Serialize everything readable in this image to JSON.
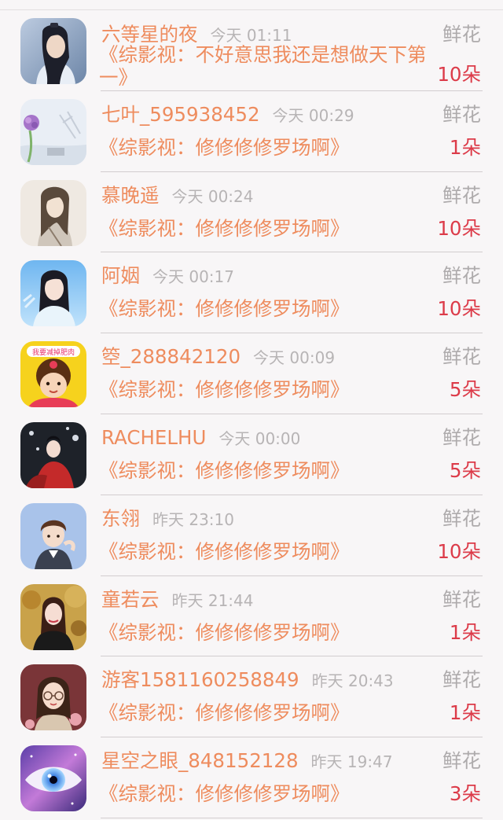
{
  "rewards": [
    {
      "name": "六等星的夜",
      "time": "今天 01:11",
      "gift": "鲜花",
      "book": "《综影视：不好意思我还是想做天下第一》",
      "count": "10朵",
      "avatar_icon": "avatar-photo-man-ancient"
    },
    {
      "name": "七叶_595938452",
      "time": "今天 00:29",
      "gift": "鲜花",
      "book": "《综影视：修修修修罗场啊》",
      "count": "1朵",
      "avatar_icon": "avatar-illustration-flower"
    },
    {
      "name": "慕晚遥",
      "time": "今天 00:24",
      "gift": "鲜花",
      "book": "《综影视：修修修修罗场啊》",
      "count": "10朵",
      "avatar_icon": "avatar-illustration-swordsman"
    },
    {
      "name": "阿姻",
      "time": "今天 00:17",
      "gift": "鲜花",
      "book": "《综影视：修修修修罗场啊》",
      "count": "10朵",
      "avatar_icon": "avatar-photo-girl-blue"
    },
    {
      "name": "箜_288842120",
      "time": "今天 00:09",
      "gift": "鲜花",
      "book": "《综影视：修修修修罗场啊》",
      "count": "5朵",
      "avatar_icon": "avatar-cartoon-girl-yellow"
    },
    {
      "name": "RACHELHU",
      "time": "今天 00:00",
      "gift": "鲜花",
      "book": "《综影视：修修修修罗场啊》",
      "count": "5朵",
      "avatar_icon": "avatar-photo-woman-red"
    },
    {
      "name": "东翎",
      "time": "昨天 23:10",
      "gift": "鲜花",
      "book": "《综影视：修修修修罗场啊》",
      "count": "10朵",
      "avatar_icon": "avatar-photo-boy-blue"
    },
    {
      "name": "童若云",
      "time": "昨天 21:44",
      "gift": "鲜花",
      "book": "《综影视：修修修修罗场啊》",
      "count": "1朵",
      "avatar_icon": "avatar-photo-woman-autumn"
    },
    {
      "name": "游客1581160258849",
      "time": "昨天 20:43",
      "gift": "鲜花",
      "book": "《综影视：修修修修罗场啊》",
      "count": "1朵",
      "avatar_icon": "avatar-cartoon-girl-glasses"
    },
    {
      "name": "星空之眼_848152128",
      "time": "昨天 19:47",
      "gift": "鲜花",
      "book": "《综影视：修修修修罗场啊》",
      "count": "3朵",
      "avatar_icon": "avatar-illustration-eye"
    }
  ]
}
